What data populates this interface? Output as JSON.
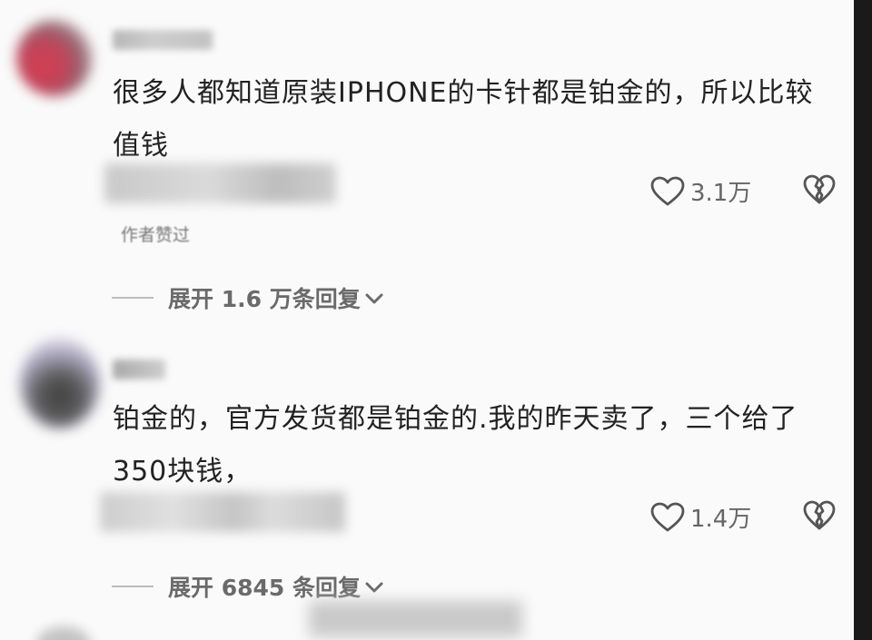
{
  "comments": [
    {
      "text": "很多人都知道原装IPHONE的卡针都是铂金的，所以比较值钱",
      "author_liked": "作者赞过",
      "likes": "3.1万",
      "expand_label": "展开 1.6 万条回复"
    },
    {
      "text": "铂金的，官方发货都是铂金的.我的昨天卖了，三个给了350块钱，",
      "likes": "1.4万",
      "expand_label": "展开 6845 条回复"
    }
  ],
  "colors": {
    "background": "#fafafa",
    "right_strip": "#1a1a1a",
    "text": "#222222",
    "muted": "#6a6a6a"
  },
  "icons": {
    "like": "heart-outline-icon",
    "dislike": "broken-heart-icon",
    "expand": "chevron-down-icon"
  }
}
